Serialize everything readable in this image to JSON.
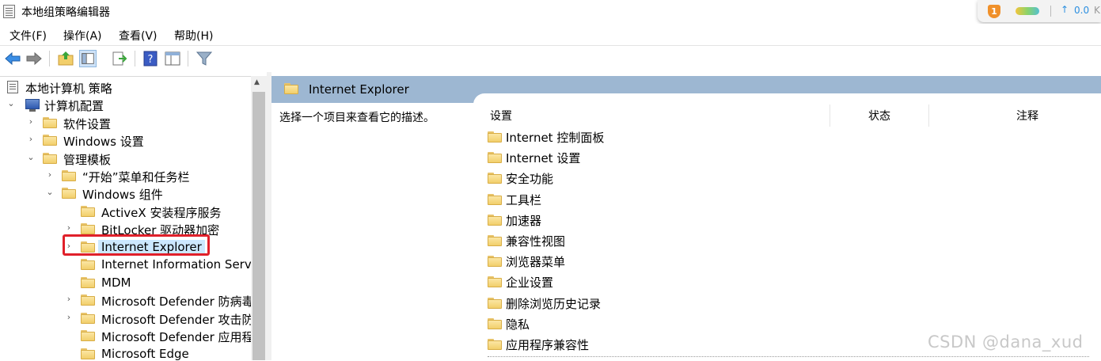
{
  "window": {
    "title": "本地组策略编辑器"
  },
  "tray": {
    "badge": "1",
    "speed": "0.0",
    "unit": "K"
  },
  "menu": [
    {
      "label": "文件(F)"
    },
    {
      "label": "操作(A)"
    },
    {
      "label": "查看(V)"
    },
    {
      "label": "帮助(H)"
    }
  ],
  "toolbar": {
    "icons": [
      "back-arrow-icon",
      "forward-arrow-icon",
      "up-folder-icon",
      "show-hide-tree-icon",
      "export-list-icon",
      "help-icon",
      "properties-view-icon",
      "filter-icon"
    ]
  },
  "tree": {
    "root": "本地计算机 策略",
    "computer_config": "计算机配置",
    "software_settings": "软件设置",
    "windows_settings": "Windows 设置",
    "admin_templates": "管理模板",
    "start_menu": "“开始”菜单和任务栏",
    "windows_components": "Windows 组件",
    "activex": "ActiveX 安装程序服务",
    "bitlocker": "BitLocker 驱动器加密",
    "ie": "Internet Explorer",
    "iis": "Internet Information Services",
    "mdm": "MDM",
    "defender_av": "Microsoft Defender 防病毒",
    "defender_exploit": "Microsoft Defender 攻击防护",
    "defender_app": "Microsoft Defender 应用程序防护",
    "edge": "Microsoft Edge"
  },
  "details": {
    "header_title": "Internet Explorer",
    "description": "选择一个项目来查看它的描述。",
    "columns": {
      "setting": "设置",
      "state": "状态",
      "comment": "注释"
    },
    "items": [
      "Internet 控制面板",
      "Internet 设置",
      "安全功能",
      "工具栏",
      "加速器",
      "兼容性视图",
      "浏览器菜单",
      "企业设置",
      "删除浏览历史记录",
      "隐私",
      "应用程序兼容性"
    ]
  },
  "watermark": "CSDN @dana_xud"
}
